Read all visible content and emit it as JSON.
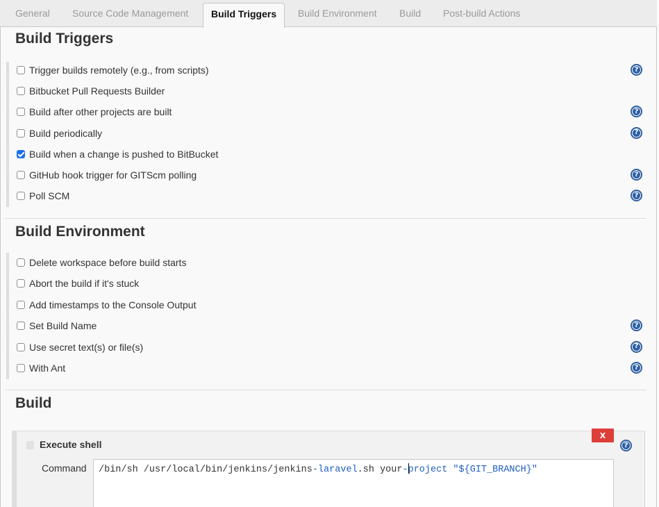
{
  "tabs": [
    {
      "label": "General",
      "active": false
    },
    {
      "label": "Source Code Management",
      "active": false
    },
    {
      "label": "Build Triggers",
      "active": true
    },
    {
      "label": "Build Environment",
      "active": false
    },
    {
      "label": "Build",
      "active": false
    },
    {
      "label": "Post-build Actions",
      "active": false
    }
  ],
  "build_triggers": {
    "title": "Build Triggers",
    "items": [
      {
        "label": "Trigger builds remotely (e.g., from scripts)",
        "checked": false,
        "help": true
      },
      {
        "label": "Bitbucket Pull Requests Builder",
        "checked": false,
        "help": false
      },
      {
        "label": "Build after other projects are built",
        "checked": false,
        "help": true
      },
      {
        "label": "Build periodically",
        "checked": false,
        "help": true
      },
      {
        "label": "Build when a change is pushed to BitBucket",
        "checked": true,
        "help": false
      },
      {
        "label": "GitHub hook trigger for GITScm polling",
        "checked": false,
        "help": true
      },
      {
        "label": "Poll SCM",
        "checked": false,
        "help": true
      }
    ]
  },
  "build_environment": {
    "title": "Build Environment",
    "items": [
      {
        "label": "Delete workspace before build starts",
        "checked": false,
        "help": false
      },
      {
        "label": "Abort the build if it's stuck",
        "checked": false,
        "help": false
      },
      {
        "label": "Add timestamps to the Console Output",
        "checked": false,
        "help": false
      },
      {
        "label": "Set Build Name",
        "checked": false,
        "help": true
      },
      {
        "label": "Use secret text(s) or file(s)",
        "checked": false,
        "help": true
      },
      {
        "label": "With Ant",
        "checked": false,
        "help": true
      }
    ]
  },
  "build": {
    "title": "Build",
    "step": {
      "title": "Execute shell",
      "delete_label": "X",
      "command_label": "Command",
      "command_parts": {
        "p1": "/bin/sh /usr/local/bin/jenkins/jenkins",
        "p2": "-laravel",
        "p3": ".sh your",
        "p4": "-",
        "p5": "project",
        "p6": " ",
        "p7": "\"${GIT_BRANCH}\""
      },
      "command_value": "/bin/sh /usr/local/bin/jenkins/jenkins-laravel.sh your-project \"${GIT_BRANCH}\""
    }
  },
  "icons": {
    "help": "help-icon",
    "help_glyph": "?"
  }
}
